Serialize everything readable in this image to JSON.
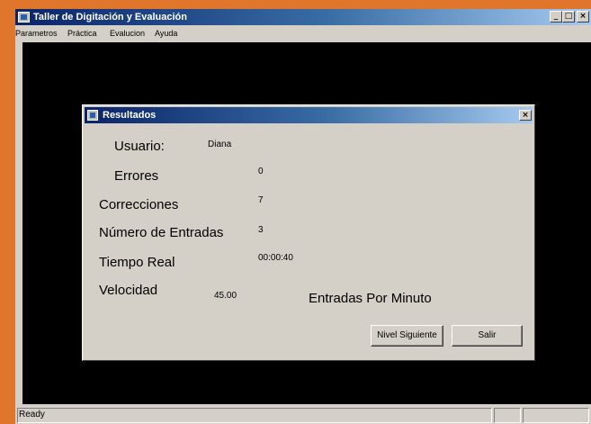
{
  "window": {
    "title": "Taller de Digitación y Evaluación",
    "minimize_glyph": "_",
    "maximize_glyph": "□",
    "close_glyph": "×"
  },
  "menu": [
    "Parametros",
    "Práctica",
    "Evalucion",
    "Ayuda"
  ],
  "status": {
    "text": "Ready"
  },
  "dialog": {
    "title": "Resultados",
    "close_glyph": "×",
    "fields": {
      "usuario_label": "Usuario:",
      "usuario_value": "Diana",
      "errores_label": "Errores",
      "errores_value": "0",
      "correcciones_label": "Correcciones",
      "correcciones_value": "7",
      "entradas_label": "Número de Entradas",
      "entradas_value": "3",
      "tiempo_label": "Tiempo Real",
      "tiempo_value": "00:00:40",
      "velocidad_label": "Velocidad",
      "velocidad_value": "45.00",
      "velocidad_unit": "Entradas Por Minuto"
    },
    "buttons": {
      "next": "Nivel Siguiente",
      "exit": "Salir"
    }
  },
  "colors": {
    "desktop": "#e0762c",
    "titlebar_start": "#0a246a",
    "titlebar_end": "#a6caf0",
    "workarea": "#000000",
    "chrome": "#d4d0c8"
  }
}
